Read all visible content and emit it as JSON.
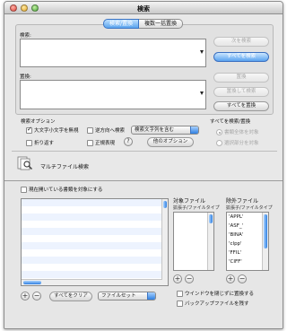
{
  "window": {
    "title": "検索"
  },
  "tabs": [
    {
      "label": "検索/置換"
    },
    {
      "label": "複数一括置換"
    }
  ],
  "search": {
    "label": "検索:"
  },
  "replace": {
    "label": "置換:"
  },
  "buttons": {
    "find_next": "次を検索",
    "find_all": "すべてを検索",
    "replace": "置換",
    "replace_and_find": "置換して検索",
    "replace_all": "すべてを置換",
    "other_options": "他のオプション",
    "clear_all": "すべてをクリア"
  },
  "options": {
    "heading": "検索オプション",
    "ignore_case": "大文字小文字を無視",
    "wrap": "折り返す",
    "backwards": "逆方向へ検索",
    "regex": "正規表現",
    "match_popup": "検索文字列を含む"
  },
  "scope": {
    "heading": "すべてを検索/置換",
    "whole_document": "書類全体を対象",
    "selection_only": "選択部分を対象"
  },
  "multi_file": {
    "label": "マルチファイル検索"
  },
  "open_docs": {
    "label": "現在開いている書類を対象にする"
  },
  "target_files": {
    "heading": "対象ファイル",
    "subheading": "拡張子/ファイルタイプ"
  },
  "exclude_files": {
    "heading": "除外ファイル",
    "subheading": "拡張子/ファイルタイプ",
    "items": [
      "'APPL'",
      "'ASF_'",
      "'BINA'",
      "'clpp'",
      "'FFIL'",
      "'CIFF'"
    ]
  },
  "fileset": {
    "label": "ファイルセット"
  },
  "checkboxes": {
    "close_after_replace": "ウインドウを閉じずに置換する",
    "save_backup": "バックアップファイルを残す"
  },
  "icons": {
    "close": "close-icon",
    "minimize": "minimize-icon",
    "zoom": "zoom-icon",
    "multi_file": "magnifier-documents-icon",
    "help": "help-icon"
  },
  "colors": {
    "accent": "#3a86e8",
    "stripe": "#edf3fe"
  }
}
